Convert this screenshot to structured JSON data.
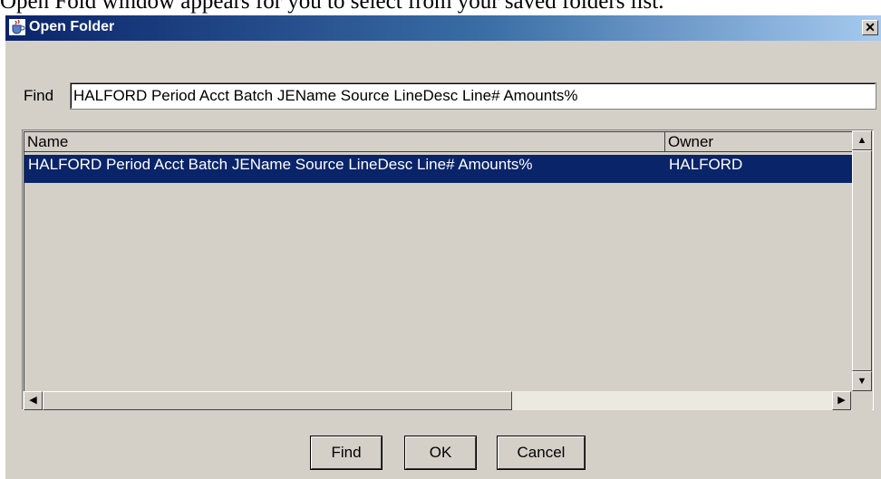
{
  "document_text": "Open Fold window appears for you to select from your saved folders list.",
  "window": {
    "title": "Open Folder",
    "close_glyph": "✕",
    "title_icon": "java-cup-icon"
  },
  "find": {
    "label": "Find",
    "value": "HALFORD Period Acct Batch JEName Source LineDesc Line# Amounts%"
  },
  "table": {
    "columns": [
      "Name",
      "Owner"
    ],
    "rows": [
      {
        "name": "HALFORD Period Acct Batch JEName Source LineDesc Line# Amounts%",
        "owner": "HALFORD",
        "selected": true
      }
    ]
  },
  "scrollbars": {
    "up_glyph": "▲",
    "down_glyph": "▼",
    "left_glyph": "◀",
    "right_glyph": "▶"
  },
  "buttons": {
    "find_label": "Find",
    "ok_label": "OK",
    "cancel_label": "Cancel"
  },
  "colors": {
    "selection": "#0a246a",
    "dialog_bg": "#d4d0c8"
  }
}
